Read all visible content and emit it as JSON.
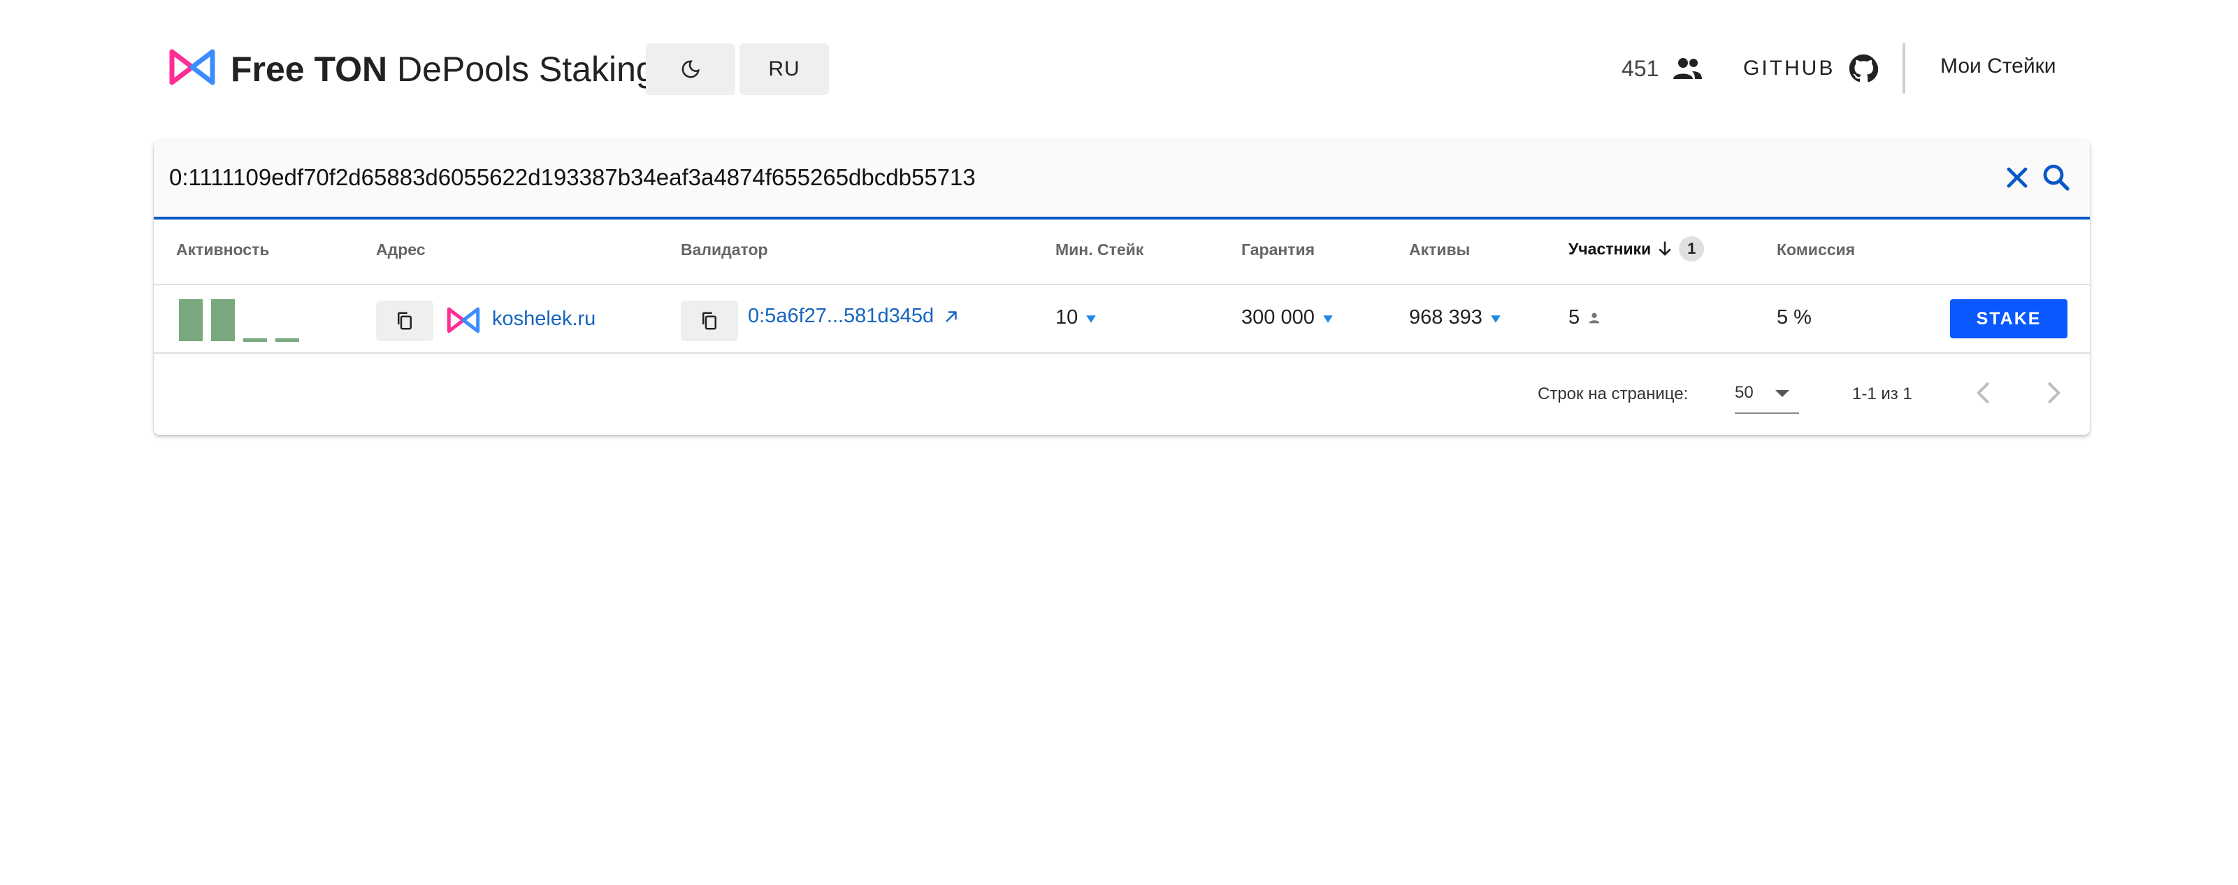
{
  "header": {
    "brand_bold": "Free TON",
    "brand_rest": " DePools Staking",
    "lang_button": "RU",
    "users_count": "451",
    "github_label": "GITHUB",
    "my_stakes": "Мои Стейки",
    "logo_colors": [
      "#ff2d95",
      "#3b8cff"
    ]
  },
  "search": {
    "value": "0:1111109edf70f2d65883d6055622d193387b34eaf3a4874f655265dbcdb55713",
    "accent_color": "#0a58c8"
  },
  "table": {
    "columns": {
      "activity": "Активность",
      "address": "Адрес",
      "validator": "Валидатор",
      "min_stake": "Мин. Стейк",
      "guarantee": "Гарантия",
      "assets": "Активы",
      "participants": "Участники",
      "participants_sort_badge": "1",
      "commission": "Комиссия"
    },
    "rows": [
      {
        "activity_levels": [
          1,
          1,
          0,
          0
        ],
        "address_name": "koshelek.ru",
        "validator": "0:5a6f27...581d345d",
        "min_stake": "10",
        "guarantee": "300 000",
        "assets": "968 393",
        "participants": "5",
        "commission": "5 %",
        "stake_button": "STAKE"
      }
    ]
  },
  "pagination": {
    "rows_per_page_label": "Строк на странице:",
    "rows_per_page_value": "50",
    "range": "1-1 из 1"
  },
  "colors": {
    "link": "#1565c0",
    "stake_button": "#0a58ff",
    "activity_bar": "#7aa87e",
    "ton_icon": "#1e88e5"
  }
}
